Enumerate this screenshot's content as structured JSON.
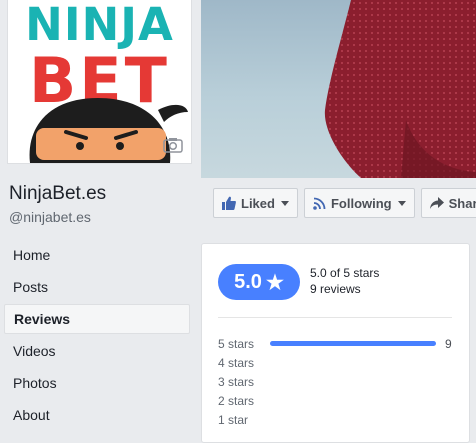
{
  "page": {
    "name": "NinjaBet.es",
    "handle": "@ninjabet.es"
  },
  "logo": {
    "line1": "NINJA",
    "line2": "BET"
  },
  "nav": {
    "items": [
      {
        "label": "Home"
      },
      {
        "label": "Posts"
      },
      {
        "label": "Reviews"
      },
      {
        "label": "Videos"
      },
      {
        "label": "Photos"
      },
      {
        "label": "About"
      }
    ],
    "active": "Reviews"
  },
  "actions": {
    "liked": "Liked",
    "following": "Following",
    "share": "Share"
  },
  "reviews": {
    "rating": "5.0",
    "summary": "5.0 of 5 stars",
    "count": "9 reviews",
    "breakdown": [
      {
        "label": "5 stars",
        "count": "9",
        "fraction": 1.0
      },
      {
        "label": "4 stars",
        "count": "",
        "fraction": 0
      },
      {
        "label": "3 stars",
        "count": "",
        "fraction": 0
      },
      {
        "label": "2 stars",
        "count": "",
        "fraction": 0
      },
      {
        "label": "1 star",
        "count": "",
        "fraction": 0
      }
    ]
  },
  "colors": {
    "accent": "#4880ff",
    "logo_teal": "#1ab3b3",
    "logo_red": "#e53935",
    "shirt": "#8b1e2e"
  }
}
